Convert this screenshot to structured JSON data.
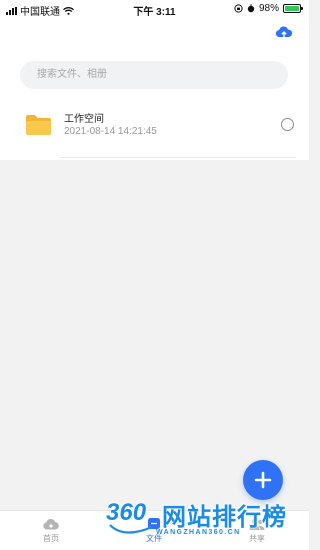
{
  "status_bar": {
    "carrier": "中国联通",
    "time": "下午 3:11",
    "battery": "98%",
    "battery_level": 0.98
  },
  "search": {
    "placeholder": "搜索文件、相册"
  },
  "files": [
    {
      "name": "工作空间",
      "date": "2021-08-14 14:21:45",
      "icon": "folder-icon"
    }
  ],
  "tabs": [
    {
      "label": "首页",
      "icon": "cloud-home-icon",
      "active": false
    },
    {
      "label": "文件",
      "icon": "file-chat-icon",
      "active": true
    },
    {
      "label": "共享",
      "icon": "share-people-icon",
      "active": false
    }
  ],
  "watermark": {
    "logo": "360",
    "title": "网站排行榜",
    "url": "WANGZHAN360.CN"
  },
  "colors": {
    "accent": "#2f72f5",
    "folder": "#f7c54a",
    "watermark": "#1a8ce6"
  }
}
